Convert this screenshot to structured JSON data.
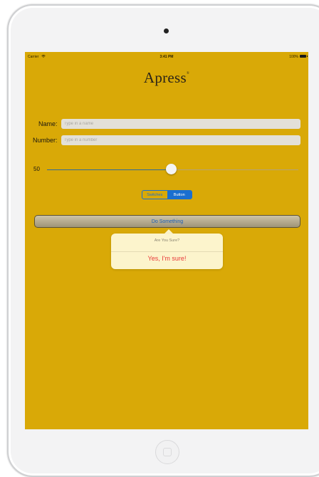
{
  "status_bar": {
    "carrier": "Carrier",
    "time": "3:41 PM",
    "battery": "100%"
  },
  "logo": {
    "text": "Apress",
    "mark": "®"
  },
  "form": {
    "name_label": "Name:",
    "name_placeholder": "Type in a name",
    "name_value": "",
    "number_label": "Number:",
    "number_placeholder": "Type in a number",
    "number_value": ""
  },
  "slider": {
    "value_label": "50",
    "value": 50,
    "min": 1,
    "max": 100
  },
  "segmented_control": {
    "segments": [
      "Switches",
      "Button"
    ],
    "selected_index": 1
  },
  "button": {
    "label": "Do Something"
  },
  "action_sheet": {
    "title": "Are You Sure?",
    "confirm_label": "Yes, I'm sure!"
  },
  "colors": {
    "background": "#d9a907",
    "accent": "#1a6fd0",
    "destructive": "#e83a3a",
    "popover": "#fcf4cc"
  }
}
